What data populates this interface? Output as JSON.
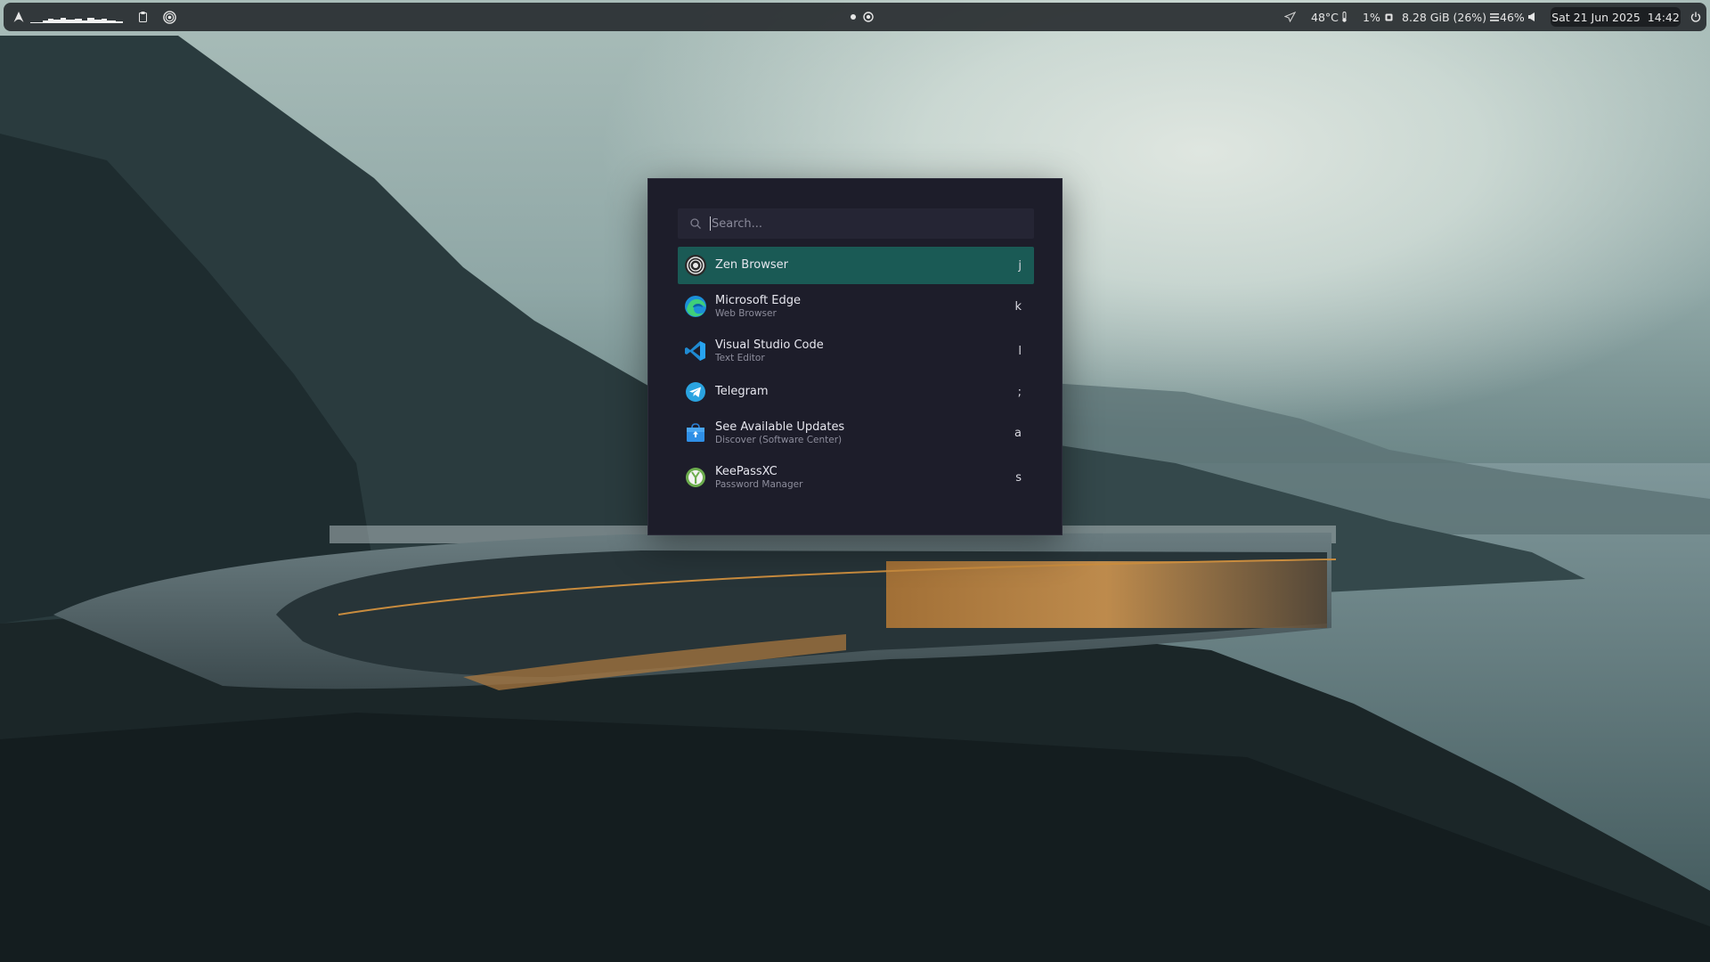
{
  "topbar": {
    "temperature": "48°C",
    "cpu_usage": "1%",
    "memory": "8.28 GiB (26%)",
    "volume": "46%",
    "clock": "Sat 21 Jun 2025  14:42"
  },
  "launcher": {
    "search_placeholder": "Search...",
    "items": [
      {
        "name": "Zen Browser",
        "description": "",
        "key": "j",
        "icon": "zen-browser-icon"
      },
      {
        "name": "Microsoft Edge",
        "description": "Web Browser",
        "key": "k",
        "icon": "edge-icon"
      },
      {
        "name": "Visual Studio Code",
        "description": "Text Editor",
        "key": "l",
        "icon": "vscode-icon"
      },
      {
        "name": "Telegram",
        "description": "",
        "key": ";",
        "icon": "telegram-icon"
      },
      {
        "name": "See Available Updates",
        "description": "Discover (Software Center)",
        "key": "a",
        "icon": "discover-icon"
      },
      {
        "name": "KeePassXC",
        "description": "Password Manager",
        "key": "s",
        "icon": "keepassxc-icon"
      }
    ]
  },
  "colors": {
    "topbar_bg": "#2b2e32",
    "launcher_bg": "#1d1d2a",
    "selection": "#1a5a55"
  }
}
